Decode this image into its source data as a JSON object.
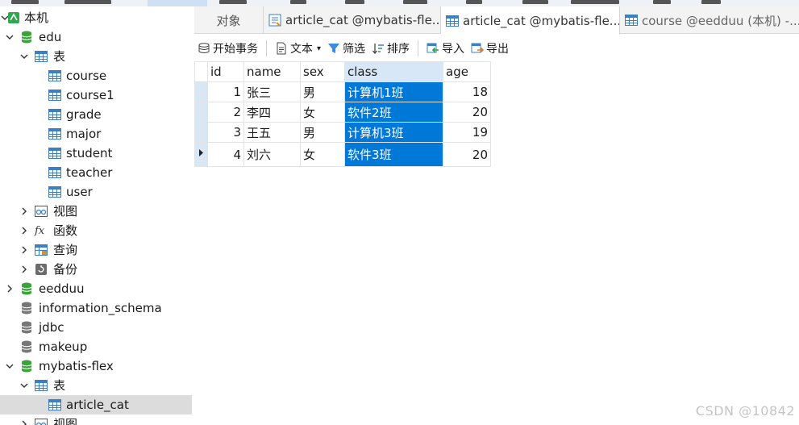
{
  "tabs": [
    {
      "label": "对象",
      "kind": "objects",
      "active": false
    },
    {
      "label": "article_cat @mybatis-fle...",
      "kind": "query",
      "active": false
    },
    {
      "label": "article_cat @mybatis-fle...",
      "kind": "table",
      "active": true
    },
    {
      "label": "course @eedduu (本机) -...",
      "kind": "table",
      "active": false
    }
  ],
  "toolbar": {
    "begin_transaction": "开始事务",
    "text": "文本",
    "filter": "筛选",
    "sort": "排序",
    "import": "导入",
    "export": "导出"
  },
  "tree": {
    "connection": "本机",
    "databases": [
      {
        "name": "edu",
        "expanded": true,
        "tables_label": "表",
        "tables": [
          "course",
          "course1",
          "grade",
          "major",
          "student",
          "teacher",
          "user"
        ],
        "folders": [
          "视图",
          "函数",
          "查询",
          "备份"
        ]
      },
      {
        "name": "eedduu",
        "expanded": false
      },
      {
        "name": "information_schema",
        "expanded": false
      },
      {
        "name": "jdbc",
        "expanded": false
      },
      {
        "name": "makeup",
        "expanded": false
      },
      {
        "name": "mybatis-flex",
        "expanded": true,
        "tables_label": "表",
        "tables": [
          "article_cat"
        ],
        "folders": [
          "视图"
        ]
      }
    ]
  },
  "grid": {
    "columns": [
      "id",
      "name",
      "sex",
      "class",
      "age"
    ],
    "rows": [
      {
        "id": "1",
        "name": "张三",
        "sex": "男",
        "class": "计算机1班",
        "age": "18"
      },
      {
        "id": "2",
        "name": "李四",
        "sex": "女",
        "class": "软件2班",
        "age": "20"
      },
      {
        "id": "3",
        "name": "王五",
        "sex": "男",
        "class": "计算机3班",
        "age": "19"
      },
      {
        "id": "4",
        "name": "刘六",
        "sex": "女",
        "class": "软件3班",
        "age": "20"
      }
    ],
    "current_row": 4,
    "selected_column": "class"
  },
  "watermark": "CSDN @10842",
  "colors": {
    "db_icon": "#3aa33a",
    "db_icon_inactive": "#777777",
    "table_icon": "#3b7fc4",
    "selection": "#0078d7",
    "column_header_selected": "#d8e7f7"
  }
}
